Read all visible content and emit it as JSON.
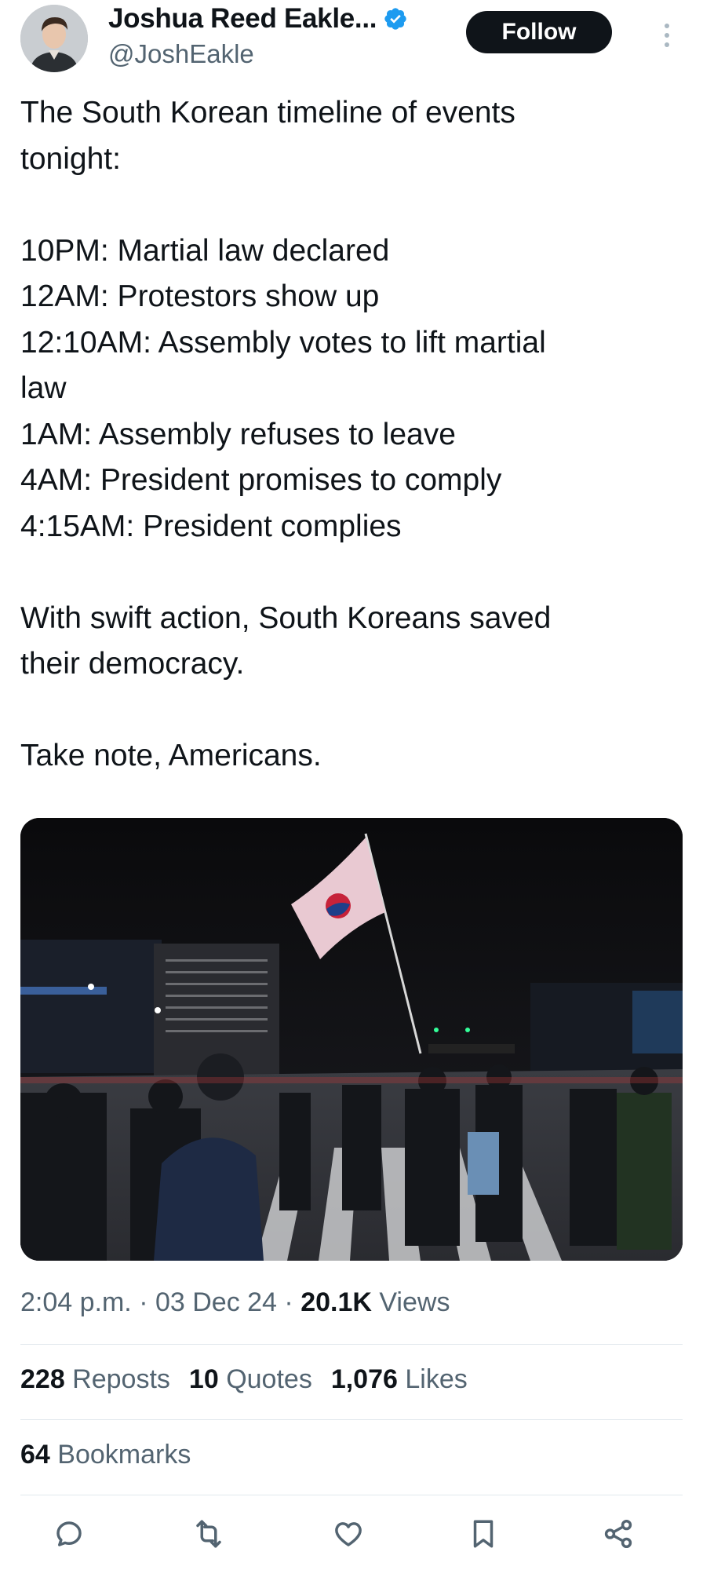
{
  "author": {
    "display_name": "Joshua Reed Eakle...",
    "handle": "@JoshEakle",
    "verified": true
  },
  "follow_button": {
    "label": "Follow"
  },
  "tweet": {
    "text": "The South Korean timeline of events\ntonight:\n\n10PM: Martial law declared\n12AM: Protestors show up\n12:10AM: Assembly votes to lift martial\nlaw\n1AM: Assembly refuses to leave\n4AM: President promises to comply\n4:15AM: President complies\n\nWith swift action, South Koreans saved\ntheir democracy.\n\nTake note, Americans."
  },
  "meta": {
    "time": "2:04 p.m.",
    "separator": " · ",
    "date": "03 Dec 24",
    "views_count": "20.1K",
    "views_label": " Views"
  },
  "stats": {
    "reposts_count": "228",
    "reposts_label": " Reposts",
    "quotes_count": "10",
    "quotes_label": " Quotes",
    "likes_count": "1,076",
    "likes_label": " Likes",
    "bookmarks_count": "64",
    "bookmarks_label": " Bookmarks"
  },
  "icons": {
    "verified": "verified-badge-icon",
    "more": "more-vertical-icon",
    "reply": "reply-icon",
    "repost": "repost-icon",
    "like": "heart-icon",
    "bookmark": "bookmark-icon",
    "share": "share-icon"
  },
  "colors": {
    "verified_blue": "#1d9bf0",
    "text_primary": "#0f1419",
    "text_secondary": "#536471",
    "divider": "#e1e8ed"
  }
}
